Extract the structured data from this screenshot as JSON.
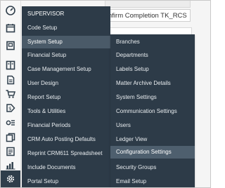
{
  "background": {
    "field_text": "nfirm Completion TK_RCS"
  },
  "sidebar": {
    "icons": [
      {
        "name": "dashboard-gauge-icon"
      },
      {
        "name": "calendar-icon"
      },
      {
        "name": "contact-card-icon"
      },
      {
        "name": "ledger-book-icon"
      },
      {
        "name": "document-icon"
      },
      {
        "name": "shopping-cart-icon"
      },
      {
        "name": "dollar-tag-icon"
      },
      {
        "name": "settings-list-icon"
      },
      {
        "name": "copy-documents-icon"
      },
      {
        "name": "reports-icon"
      },
      {
        "name": "bar-chart-icon"
      },
      {
        "name": "gear-settings-icon"
      }
    ]
  },
  "menu_level1": {
    "header": "SUPERVISOR",
    "items": [
      {
        "label": "Code Setup"
      },
      {
        "label": "System Setup"
      },
      {
        "label": "Financial Setup"
      },
      {
        "label": "Case Management Setup"
      },
      {
        "label": "User Design"
      },
      {
        "label": "Report Setup"
      },
      {
        "label": "Tools & Utilities"
      },
      {
        "label": "Financial Periods"
      },
      {
        "label": "CRM Auto Posting Defaults"
      },
      {
        "label": "Reprint CRM611 Spreadsheet"
      },
      {
        "label": "Include Documents"
      },
      {
        "label": "Portal Setup"
      }
    ],
    "selected": "System Setup"
  },
  "menu_level2": {
    "items": [
      {
        "label": "Branches"
      },
      {
        "label": "Departments"
      },
      {
        "label": "Labels Setup"
      },
      {
        "label": "Matter Archive Details"
      },
      {
        "label": "System Settings"
      },
      {
        "label": "Communication Settings"
      },
      {
        "label": "Users"
      },
      {
        "label": "Ledger View"
      },
      {
        "label": "Configuration Settings"
      },
      {
        "label": "Security Groups"
      },
      {
        "label": "Email Setup"
      }
    ],
    "highlighted": "Configuration Settings"
  },
  "colors": {
    "menu_bg": "#2d3b48",
    "menu_selected": "#4a5a68",
    "menu_text": "#e8ecef",
    "icon_color": "#2f3e4b"
  }
}
